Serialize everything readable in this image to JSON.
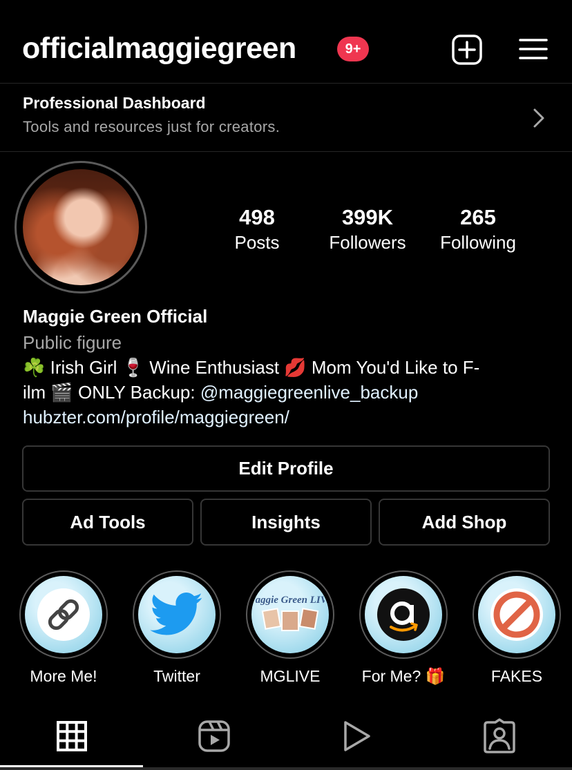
{
  "header": {
    "username": "officialmaggiegreen",
    "notification_badge": "9+",
    "badge_color": "#ef3650"
  },
  "dashboard": {
    "title": "Professional Dashboard",
    "subtitle": "Tools and resources just for creators."
  },
  "stats": [
    {
      "value": "498",
      "label": "Posts"
    },
    {
      "value": "399K",
      "label": "Followers"
    },
    {
      "value": "265",
      "label": "Following"
    }
  ],
  "bio": {
    "name": "Maggie Green Official",
    "category": "Public figure",
    "line1": "☘️ Irish Girl 🍷 Wine Enthusiast 💋 Mom You'd Like to F-",
    "line2_prefix": "ilm 🎬 ONLY Backup: ",
    "line2_mention": "@maggiegreenlive_backup",
    "link": "hubzter.com/profile/maggiegreen/"
  },
  "buttons": {
    "edit_profile": "Edit Profile",
    "ad_tools": "Ad Tools",
    "insights": "Insights",
    "add_shop": "Add Shop"
  },
  "highlights": [
    {
      "label": "More Me!",
      "icon": "link-chain-icon"
    },
    {
      "label": "Twitter",
      "icon": "twitter-bird-icon"
    },
    {
      "label": "MGLIVE",
      "icon": "mglive-logo"
    },
    {
      "label": "For Me? 🎁",
      "icon": "amazon-icon"
    },
    {
      "label": "FAKES",
      "icon": "prohibited-icon"
    }
  ],
  "mglive_logo_text": "Maggie Green LIVE",
  "tabs": [
    {
      "name": "posts-grid",
      "icon": "grid-icon",
      "active": true
    },
    {
      "name": "reels",
      "icon": "reels-icon"
    },
    {
      "name": "videos",
      "icon": "play-icon"
    },
    {
      "name": "tagged",
      "icon": "tagged-person-icon"
    }
  ]
}
